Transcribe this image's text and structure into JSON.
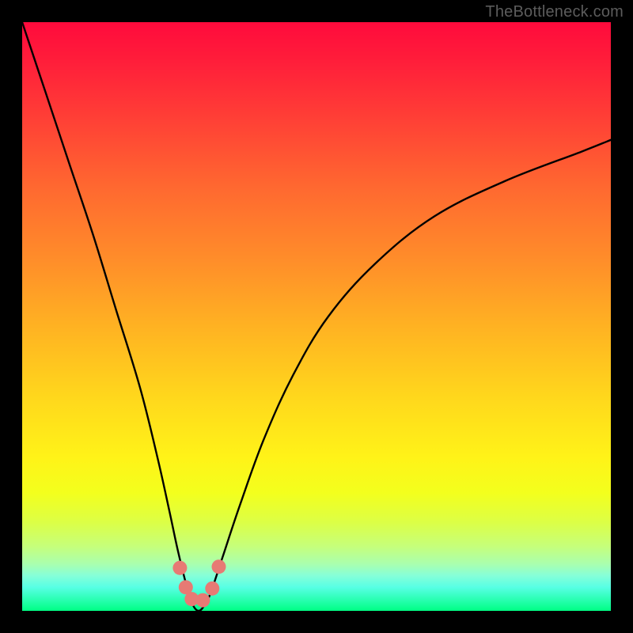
{
  "watermark": "TheBottleneck.com",
  "chart_data": {
    "type": "line",
    "title": "",
    "xlabel": "",
    "ylabel": "",
    "xlim": [
      0,
      100
    ],
    "ylim": [
      0,
      100
    ],
    "series": [
      {
        "name": "bottleneck-curve",
        "x": [
          0,
          4,
          8,
          12,
          16,
          20,
          23,
          25,
          26.5,
          28,
          29,
          30,
          31,
          32,
          34,
          37,
          41,
          46,
          52,
          60,
          70,
          82,
          95,
          100
        ],
        "values": [
          100,
          88,
          76,
          64,
          51,
          38,
          26,
          17,
          10,
          4,
          1,
          0,
          1,
          3,
          9,
          18,
          29,
          40,
          50,
          59,
          67,
          73,
          78,
          80
        ]
      }
    ],
    "markers": [
      {
        "x": 26.8,
        "y": 7.3
      },
      {
        "x": 27.8,
        "y": 4.0
      },
      {
        "x": 28.8,
        "y": 2.0
      },
      {
        "x": 30.7,
        "y": 1.8
      },
      {
        "x": 32.3,
        "y": 3.8
      },
      {
        "x": 33.4,
        "y": 7.5
      }
    ],
    "colors": {
      "curve": "#000000",
      "marker": "#e77a74",
      "gradient_top": "#ff0a3c",
      "gradient_bottom": "#00ff84"
    }
  }
}
